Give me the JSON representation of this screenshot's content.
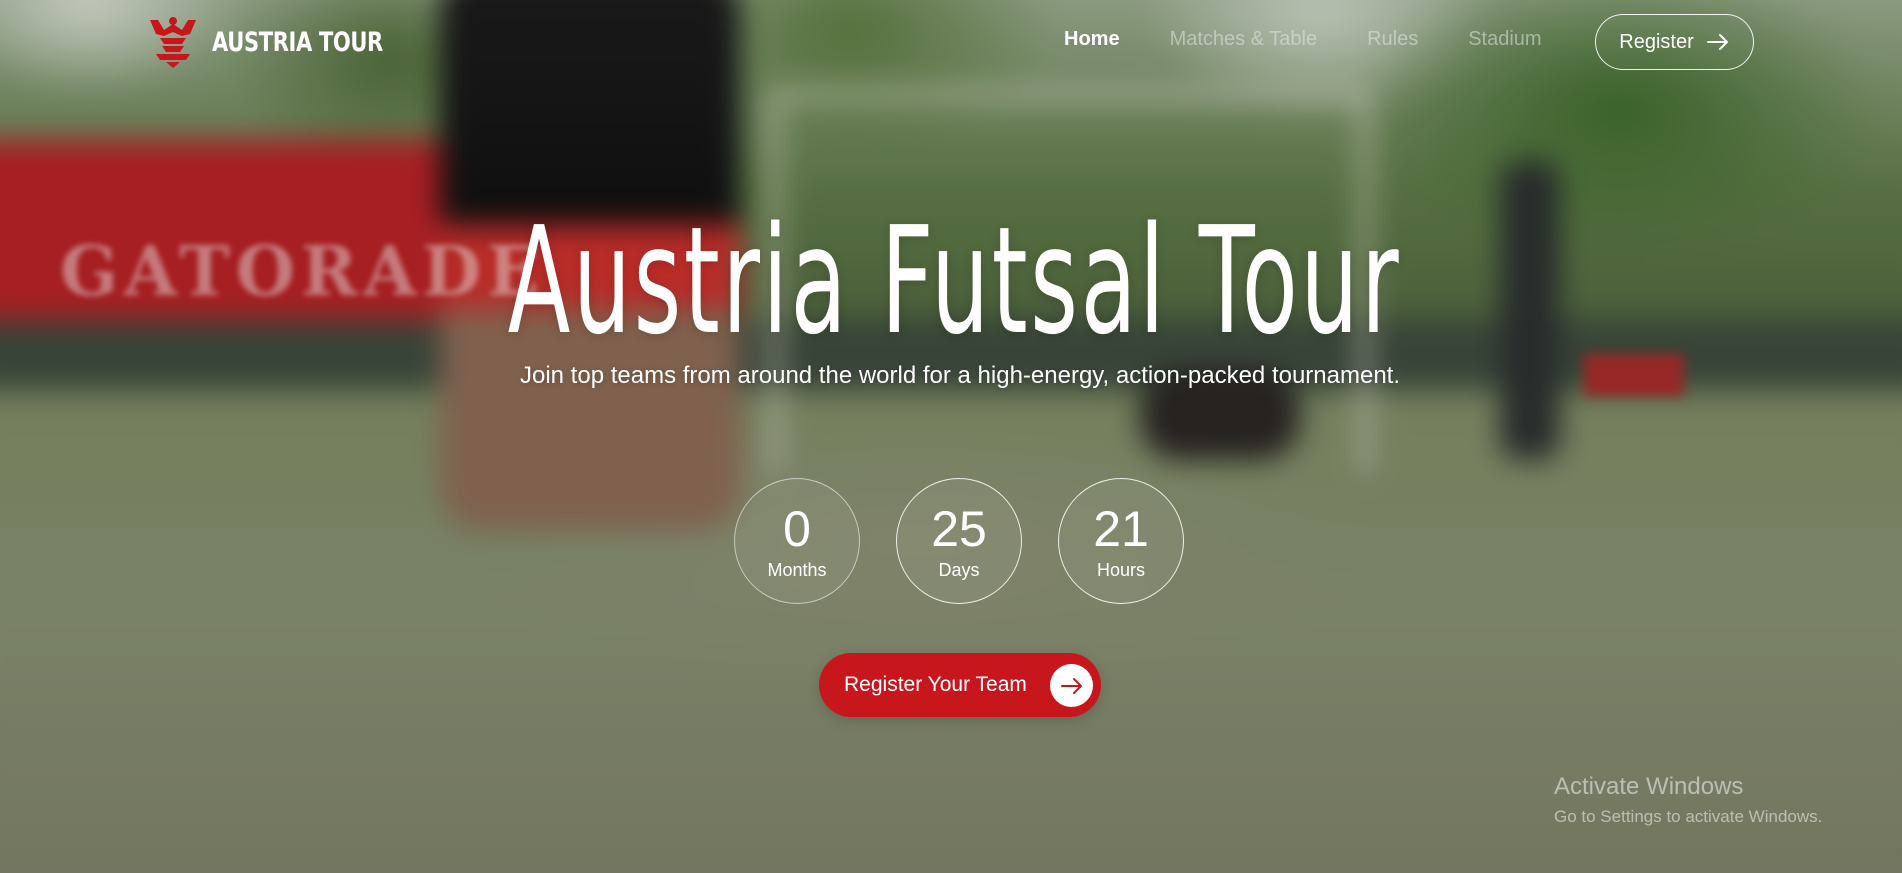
{
  "brand": {
    "name": "AUSTRIA TOUR",
    "accent_color": "#c8161d",
    "logo_icon": "eagle-crest-icon"
  },
  "nav": {
    "links": [
      {
        "label": "Home",
        "active": true
      },
      {
        "label": "Matches & Table",
        "active": false
      },
      {
        "label": "Rules",
        "active": false
      },
      {
        "label": "Stadium",
        "active": false
      }
    ],
    "register_label": "Register",
    "register_icon": "arrow-right-icon"
  },
  "hero": {
    "title": "Austria Futsal Tour",
    "subtitle": "Join top teams from around the world for a high-energy, action-packed tournament."
  },
  "countdown": [
    {
      "value": "0",
      "label": "Months"
    },
    {
      "value": "25",
      "label": "Days"
    },
    {
      "value": "21",
      "label": "Hours"
    }
  ],
  "cta": {
    "label": "Register Your Team",
    "icon": "arrow-right-icon"
  },
  "background": {
    "banner_text": "GATORADE"
  },
  "watermark": {
    "title": "Activate Windows",
    "subtitle": "Go to Settings to activate Windows."
  }
}
